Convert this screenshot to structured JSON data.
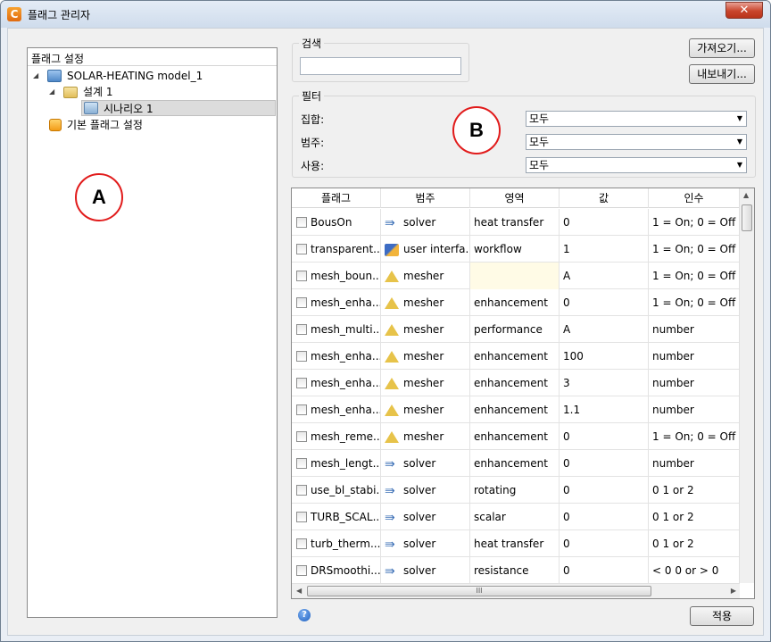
{
  "window": {
    "title": "플래그 관리자",
    "app_icon": "C",
    "close_glyph": "✕"
  },
  "tree": {
    "header": "플래그 설정",
    "model": "SOLAR-HEATING model_1",
    "design": "설계 1",
    "scenario": "시나리오 1",
    "default_flags": "기본 플래그 설정"
  },
  "search": {
    "label": "검색",
    "value": ""
  },
  "buttons": {
    "import": "가져오기...",
    "export": "내보내기...",
    "apply": "적용"
  },
  "filter": {
    "label": "필터",
    "set_label": "집합:",
    "category_label": "범주:",
    "usage_label": "사용:",
    "set_value": "모두",
    "category_value": "모두",
    "usage_value": "모두"
  },
  "table": {
    "headers": {
      "flag": "플래그",
      "category": "범주",
      "area": "영역",
      "value": "값",
      "argument": "인수"
    },
    "rows": [
      {
        "flag": "BousOn",
        "cat": "solver",
        "area": "heat transfer",
        "value": "0",
        "arg": "1 = On; 0 = Off"
      },
      {
        "flag": "transparent...",
        "cat": "user interfa...",
        "area": "workflow",
        "value": "1",
        "arg": "1 = On; 0 = Off"
      },
      {
        "flag": "mesh_boun...",
        "cat": "mesher",
        "area": "",
        "value": "A",
        "arg": "1 = On; 0 = Off"
      },
      {
        "flag": "mesh_enha...",
        "cat": "mesher",
        "area": "enhancement",
        "value": "0",
        "arg": "1 = On; 0 = Off"
      },
      {
        "flag": "mesh_multi...",
        "cat": "mesher",
        "area": "performance",
        "value": "A",
        "arg": "number"
      },
      {
        "flag": "mesh_enha...",
        "cat": "mesher",
        "area": "enhancement",
        "value": "100",
        "arg": "number"
      },
      {
        "flag": "mesh_enha...",
        "cat": "mesher",
        "area": "enhancement",
        "value": "3",
        "arg": "number"
      },
      {
        "flag": "mesh_enha...",
        "cat": "mesher",
        "area": "enhancement",
        "value": "1.1",
        "arg": "number"
      },
      {
        "flag": "mesh_reme...",
        "cat": "mesher",
        "area": "enhancement",
        "value": "0",
        "arg": "1 = On; 0 = Off"
      },
      {
        "flag": "mesh_lengt...",
        "cat": "solver",
        "area": "enhancement",
        "value": "0",
        "arg": "number"
      },
      {
        "flag": "use_bl_stabi...",
        "cat": "solver",
        "area": "rotating",
        "value": "0",
        "arg": "0  1 or 2"
      },
      {
        "flag": "TURB_SCAL...",
        "cat": "solver",
        "area": "scalar",
        "value": "0",
        "arg": "0  1 or 2"
      },
      {
        "flag": "turb_therm...",
        "cat": "solver",
        "area": "heat transfer",
        "value": "0",
        "arg": "0  1  or 2"
      },
      {
        "flag": "DRSmoothi...",
        "cat": "solver",
        "area": "resistance",
        "value": "0",
        "arg": "< 0 0 or > 0"
      }
    ]
  },
  "hscroll_grip": "III",
  "help_glyph": "?",
  "callouts": {
    "a": "A",
    "b": "B"
  }
}
